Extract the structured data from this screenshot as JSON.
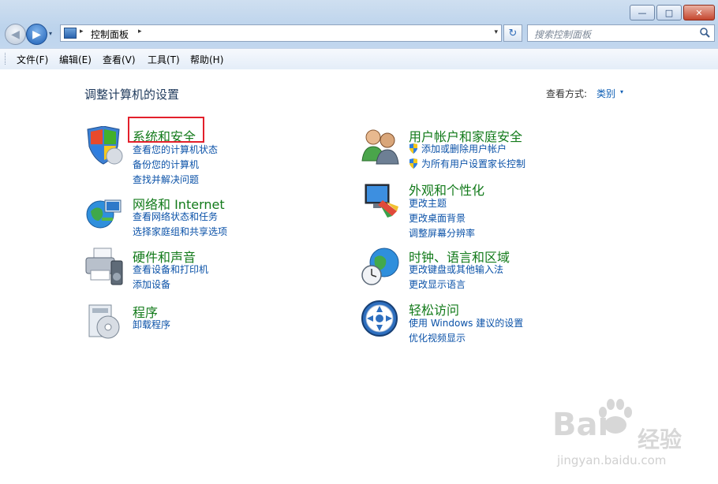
{
  "window": {
    "minimize_glyph": "—",
    "maximize_glyph": "□",
    "close_glyph": "✕"
  },
  "nav": {
    "back_glyph": "◀",
    "forward_glyph": "▶",
    "dropdown_glyph": "▾",
    "address_sep": "▸",
    "breadcrumb": "控制面板",
    "address_dropdown_glyph": "▾",
    "refresh_glyph": "↻",
    "search_placeholder": "搜索控制面板"
  },
  "menubar": {
    "items": [
      "文件(F)",
      "编辑(E)",
      "查看(V)",
      "工具(T)",
      "帮助(H)"
    ]
  },
  "content": {
    "heading": "调整计算机的设置",
    "view_by_label": "查看方式:",
    "view_by_value": "类别",
    "view_by_dropdown": "▾",
    "categories": [
      {
        "title": "系统和安全",
        "icon": "shield-security-icon",
        "links": [
          "查看您的计算机状态",
          "备份您的计算机",
          "查找并解决问题"
        ]
      },
      {
        "title": "网络和 Internet",
        "icon": "network-globe-icon",
        "links": [
          "查看网络状态和任务",
          "选择家庭组和共享选项"
        ]
      },
      {
        "title": "硬件和声音",
        "icon": "printer-speaker-icon",
        "links": [
          "查看设备和打印机",
          "添加设备"
        ]
      },
      {
        "title": "程序",
        "icon": "programs-disc-icon",
        "links": [
          "卸载程序"
        ]
      },
      {
        "title": "用户帐户和家庭安全",
        "icon": "users-icon",
        "links": [
          "添加或删除用户帐户",
          "为所有用户设置家长控制"
        ]
      },
      {
        "title": "外观和个性化",
        "icon": "monitor-palette-icon",
        "links": [
          "更改主题",
          "更改桌面背景",
          "调整屏幕分辨率"
        ]
      },
      {
        "title": "时钟、语言和区域",
        "icon": "clock-globe-icon",
        "links": [
          "更改键盘或其他输入法",
          "更改显示语言"
        ]
      },
      {
        "title": "轻松访问",
        "icon": "ease-of-access-icon",
        "links": [
          "使用 Windows 建议的设置",
          "优化视频显示"
        ]
      }
    ]
  },
  "watermark": {
    "logo_text": "Bai",
    "logo_suffix": "经验",
    "url": "jingyan.baidu.com"
  },
  "colors": {
    "category_title": "#127a1a",
    "link": "#0b52a8",
    "highlight_box": "#e3202b",
    "chrome_blue": "#bcd3ec"
  }
}
